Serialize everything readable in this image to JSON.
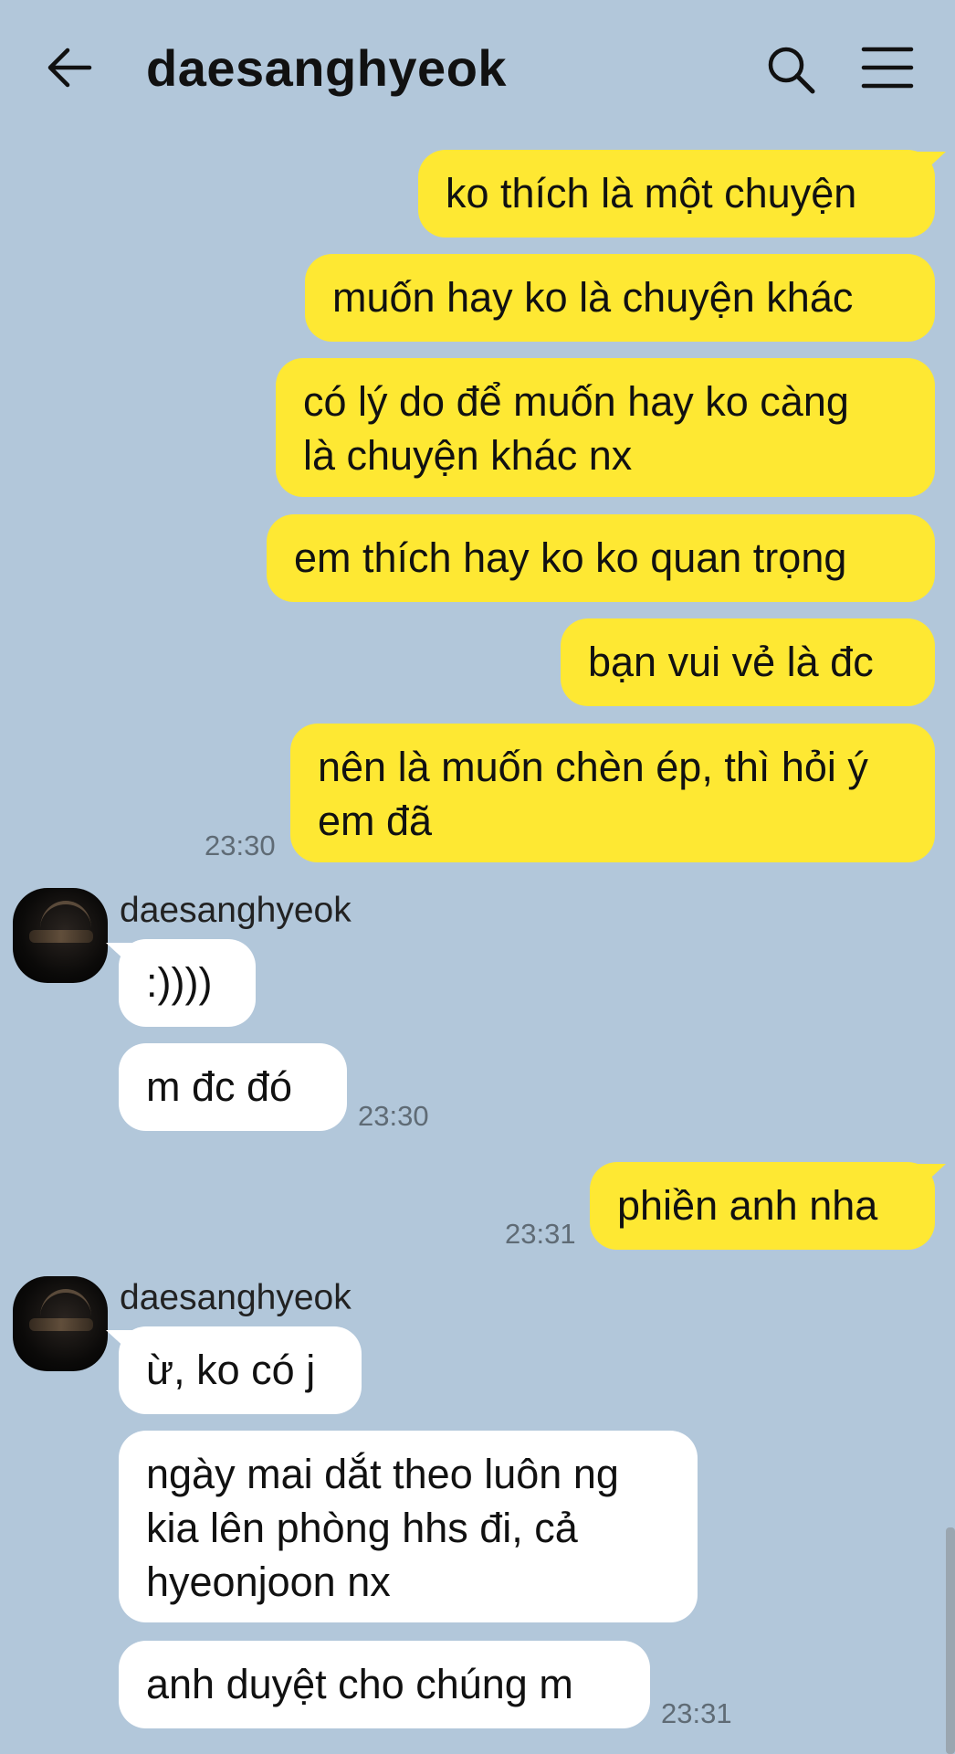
{
  "header": {
    "title": "daesanghyeok",
    "back_icon": "arrow-left-icon",
    "search_icon": "search-icon",
    "menu_icon": "hamburger-menu-icon"
  },
  "colors": {
    "background": "#b2c7da",
    "outgoing_bubble": "#fee833",
    "incoming_bubble": "#ffffff"
  },
  "messages": [
    {
      "dir": "out",
      "text": [
        "ko thích là một chuyện"
      ]
    },
    {
      "dir": "out",
      "text": [
        "muốn hay ko là chuyện khác"
      ]
    },
    {
      "dir": "out",
      "text": [
        "có lý do để muốn hay ko càng",
        "là chuyện khác nx"
      ]
    },
    {
      "dir": "out",
      "text": [
        "em thích hay ko ko quan trọng"
      ]
    },
    {
      "dir": "out",
      "text": [
        "bạn vui vẻ là đc"
      ]
    },
    {
      "dir": "out",
      "text": [
        "nên là muốn chèn ép, thì hỏi ý",
        "em đã"
      ],
      "time": "23:30"
    },
    {
      "dir": "in",
      "sender": "daesanghyeok",
      "text": [
        ":))))"
      ]
    },
    {
      "dir": "in",
      "text": [
        "m đc đó"
      ],
      "time": "23:30"
    },
    {
      "dir": "out",
      "text": [
        "phiền anh nha"
      ],
      "time": "23:31"
    },
    {
      "dir": "in",
      "sender": "daesanghyeok",
      "text": [
        "ừ, ko có j"
      ]
    },
    {
      "dir": "in",
      "text": [
        "ngày mai dắt theo luôn ng",
        "kia lên phòng hhs đi, cả",
        "hyeonjoon nx"
      ]
    },
    {
      "dir": "in",
      "text": [
        "anh duyệt cho chúng m"
      ],
      "time": "23:31"
    }
  ]
}
